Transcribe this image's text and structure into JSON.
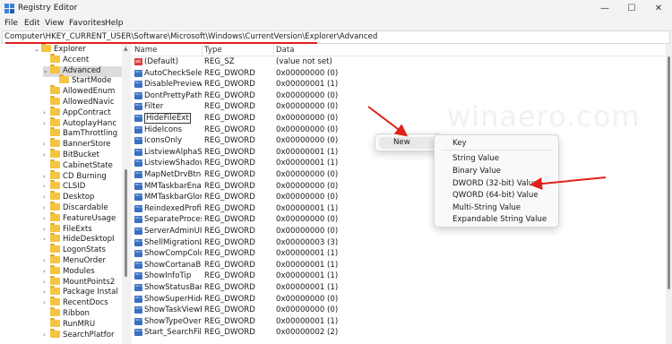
{
  "window": {
    "title": "Registry Editor",
    "controls": {
      "minimize": "—",
      "maximize": "☐",
      "close": "✕"
    }
  },
  "menubar": [
    "File",
    "Edit",
    "View",
    "Favorites",
    "Help"
  ],
  "address": "Computer\\HKEY_CURRENT_USER\\Software\\Microsoft\\Windows\\CurrentVersion\\Explorer\\Advanced",
  "tree": {
    "items": [
      {
        "label": "Explorer",
        "expander": "⌄",
        "level": 0
      },
      {
        "label": "Accent",
        "expander": "",
        "level": 1
      },
      {
        "label": "Advanced",
        "expander": "⌄",
        "level": 1,
        "selected": true
      },
      {
        "label": "StartMode",
        "expander": "",
        "level": 2
      },
      {
        "label": "AllowedEnum",
        "expander": "",
        "level": 1
      },
      {
        "label": "AllowedNavic",
        "expander": "",
        "level": 1
      },
      {
        "label": "AppContract",
        "expander": "›",
        "level": 1
      },
      {
        "label": "AutoplayHanc",
        "expander": "›",
        "level": 1
      },
      {
        "label": "BamThrottling",
        "expander": "",
        "level": 1
      },
      {
        "label": "BannerStore",
        "expander": "›",
        "level": 1
      },
      {
        "label": "BitBucket",
        "expander": "›",
        "level": 1
      },
      {
        "label": "CabinetState",
        "expander": "",
        "level": 1
      },
      {
        "label": "CD Burning",
        "expander": "›",
        "level": 1
      },
      {
        "label": "CLSID",
        "expander": "›",
        "level": 1
      },
      {
        "label": "Desktop",
        "expander": "›",
        "level": 1
      },
      {
        "label": "Discardable",
        "expander": "›",
        "level": 1
      },
      {
        "label": "FeatureUsage",
        "expander": "›",
        "level": 1
      },
      {
        "label": "FileExts",
        "expander": "›",
        "level": 1
      },
      {
        "label": "HideDesktopI",
        "expander": "›",
        "level": 1
      },
      {
        "label": "LogonStats",
        "expander": "",
        "level": 1
      },
      {
        "label": "MenuOrder",
        "expander": "›",
        "level": 1
      },
      {
        "label": "Modules",
        "expander": "›",
        "level": 1
      },
      {
        "label": "MountPoints2",
        "expander": "›",
        "level": 1
      },
      {
        "label": "Package Instal",
        "expander": "›",
        "level": 1
      },
      {
        "label": "RecentDocs",
        "expander": "›",
        "level": 1
      },
      {
        "label": "Ribbon",
        "expander": "",
        "level": 1
      },
      {
        "label": "RunMRU",
        "expander": "",
        "level": 1
      },
      {
        "label": "SearchPlatfor",
        "expander": "›",
        "level": 1
      }
    ]
  },
  "list": {
    "headers": {
      "name": "Name",
      "type": "Type",
      "data": "Data"
    },
    "rows": [
      {
        "name": "(Default)",
        "type": "REG_SZ",
        "data": "(value not set)",
        "icon": "sz"
      },
      {
        "name": "AutoCheckSelect",
        "type": "REG_DWORD",
        "data": "0x00000000 (0)",
        "icon": "dw"
      },
      {
        "name": "DisablePreviewD...",
        "type": "REG_DWORD",
        "data": "0x00000001 (1)",
        "icon": "dw"
      },
      {
        "name": "DontPrettyPath",
        "type": "REG_DWORD",
        "data": "0x00000000 (0)",
        "icon": "dw"
      },
      {
        "name": "Filter",
        "type": "REG_DWORD",
        "data": "0x00000000 (0)",
        "icon": "dw"
      },
      {
        "name": "HideFileExt",
        "type": "REG_DWORD",
        "data": "0x00000000 (0)",
        "icon": "dw",
        "editing": true
      },
      {
        "name": "HideIcons",
        "type": "REG_DWORD",
        "data": "0x00000000 (0)",
        "icon": "dw"
      },
      {
        "name": "IconsOnly",
        "type": "REG_DWORD",
        "data": "0x00000000 (0)",
        "icon": "dw"
      },
      {
        "name": "ListviewAlphaSel...",
        "type": "REG_DWORD",
        "data": "0x00000001 (1)",
        "icon": "dw"
      },
      {
        "name": "ListviewShadow",
        "type": "REG_DWORD",
        "data": "0x00000001 (1)",
        "icon": "dw"
      },
      {
        "name": "MapNetDrvBtn",
        "type": "REG_DWORD",
        "data": "0x00000000 (0)",
        "icon": "dw"
      },
      {
        "name": "MMTaskbarEnabl...",
        "type": "REG_DWORD",
        "data": "0x00000000 (0)",
        "icon": "dw"
      },
      {
        "name": "MMTaskbarGlom...",
        "type": "REG_DWORD",
        "data": "0x00000000 (0)",
        "icon": "dw"
      },
      {
        "name": "ReindexedProfile",
        "type": "REG_DWORD",
        "data": "0x00000001 (1)",
        "icon": "dw"
      },
      {
        "name": "SeparateProcess",
        "type": "REG_DWORD",
        "data": "0x00000000 (0)",
        "icon": "dw"
      },
      {
        "name": "ServerAdminUI",
        "type": "REG_DWORD",
        "data": "0x00000000 (0)",
        "icon": "dw"
      },
      {
        "name": "ShellMigrationLe...",
        "type": "REG_DWORD",
        "data": "0x00000003 (3)",
        "icon": "dw"
      },
      {
        "name": "ShowCompColor",
        "type": "REG_DWORD",
        "data": "0x00000001 (1)",
        "icon": "dw"
      },
      {
        "name": "ShowCortanaBut...",
        "type": "REG_DWORD",
        "data": "0x00000001 (1)",
        "icon": "dw"
      },
      {
        "name": "ShowInfoTip",
        "type": "REG_DWORD",
        "data": "0x00000001 (1)",
        "icon": "dw"
      },
      {
        "name": "ShowStatusBar",
        "type": "REG_DWORD",
        "data": "0x00000001 (1)",
        "icon": "dw"
      },
      {
        "name": "ShowSuperHidd...",
        "type": "REG_DWORD",
        "data": "0x00000000 (0)",
        "icon": "dw"
      },
      {
        "name": "ShowTaskViewBu...",
        "type": "REG_DWORD",
        "data": "0x00000000 (0)",
        "icon": "dw"
      },
      {
        "name": "ShowTypeOverlay",
        "type": "REG_DWORD",
        "data": "0x00000001 (1)",
        "icon": "dw"
      },
      {
        "name": "Start_SearchFiles",
        "type": "REG_DWORD",
        "data": "0x00000002 (2)",
        "icon": "dw"
      }
    ]
  },
  "context_menu": {
    "new_label": "New",
    "submenu_chevron": "›",
    "submenu": [
      "Key",
      "String Value",
      "Binary Value",
      "DWORD (32-bit) Value",
      "QWORD (64-bit) Value",
      "Multi-String Value",
      "Expandable String Value"
    ]
  },
  "watermark": "winaero.com",
  "colors": {
    "annotation_arrow": "#e0201b",
    "folder": "#f5c440"
  }
}
